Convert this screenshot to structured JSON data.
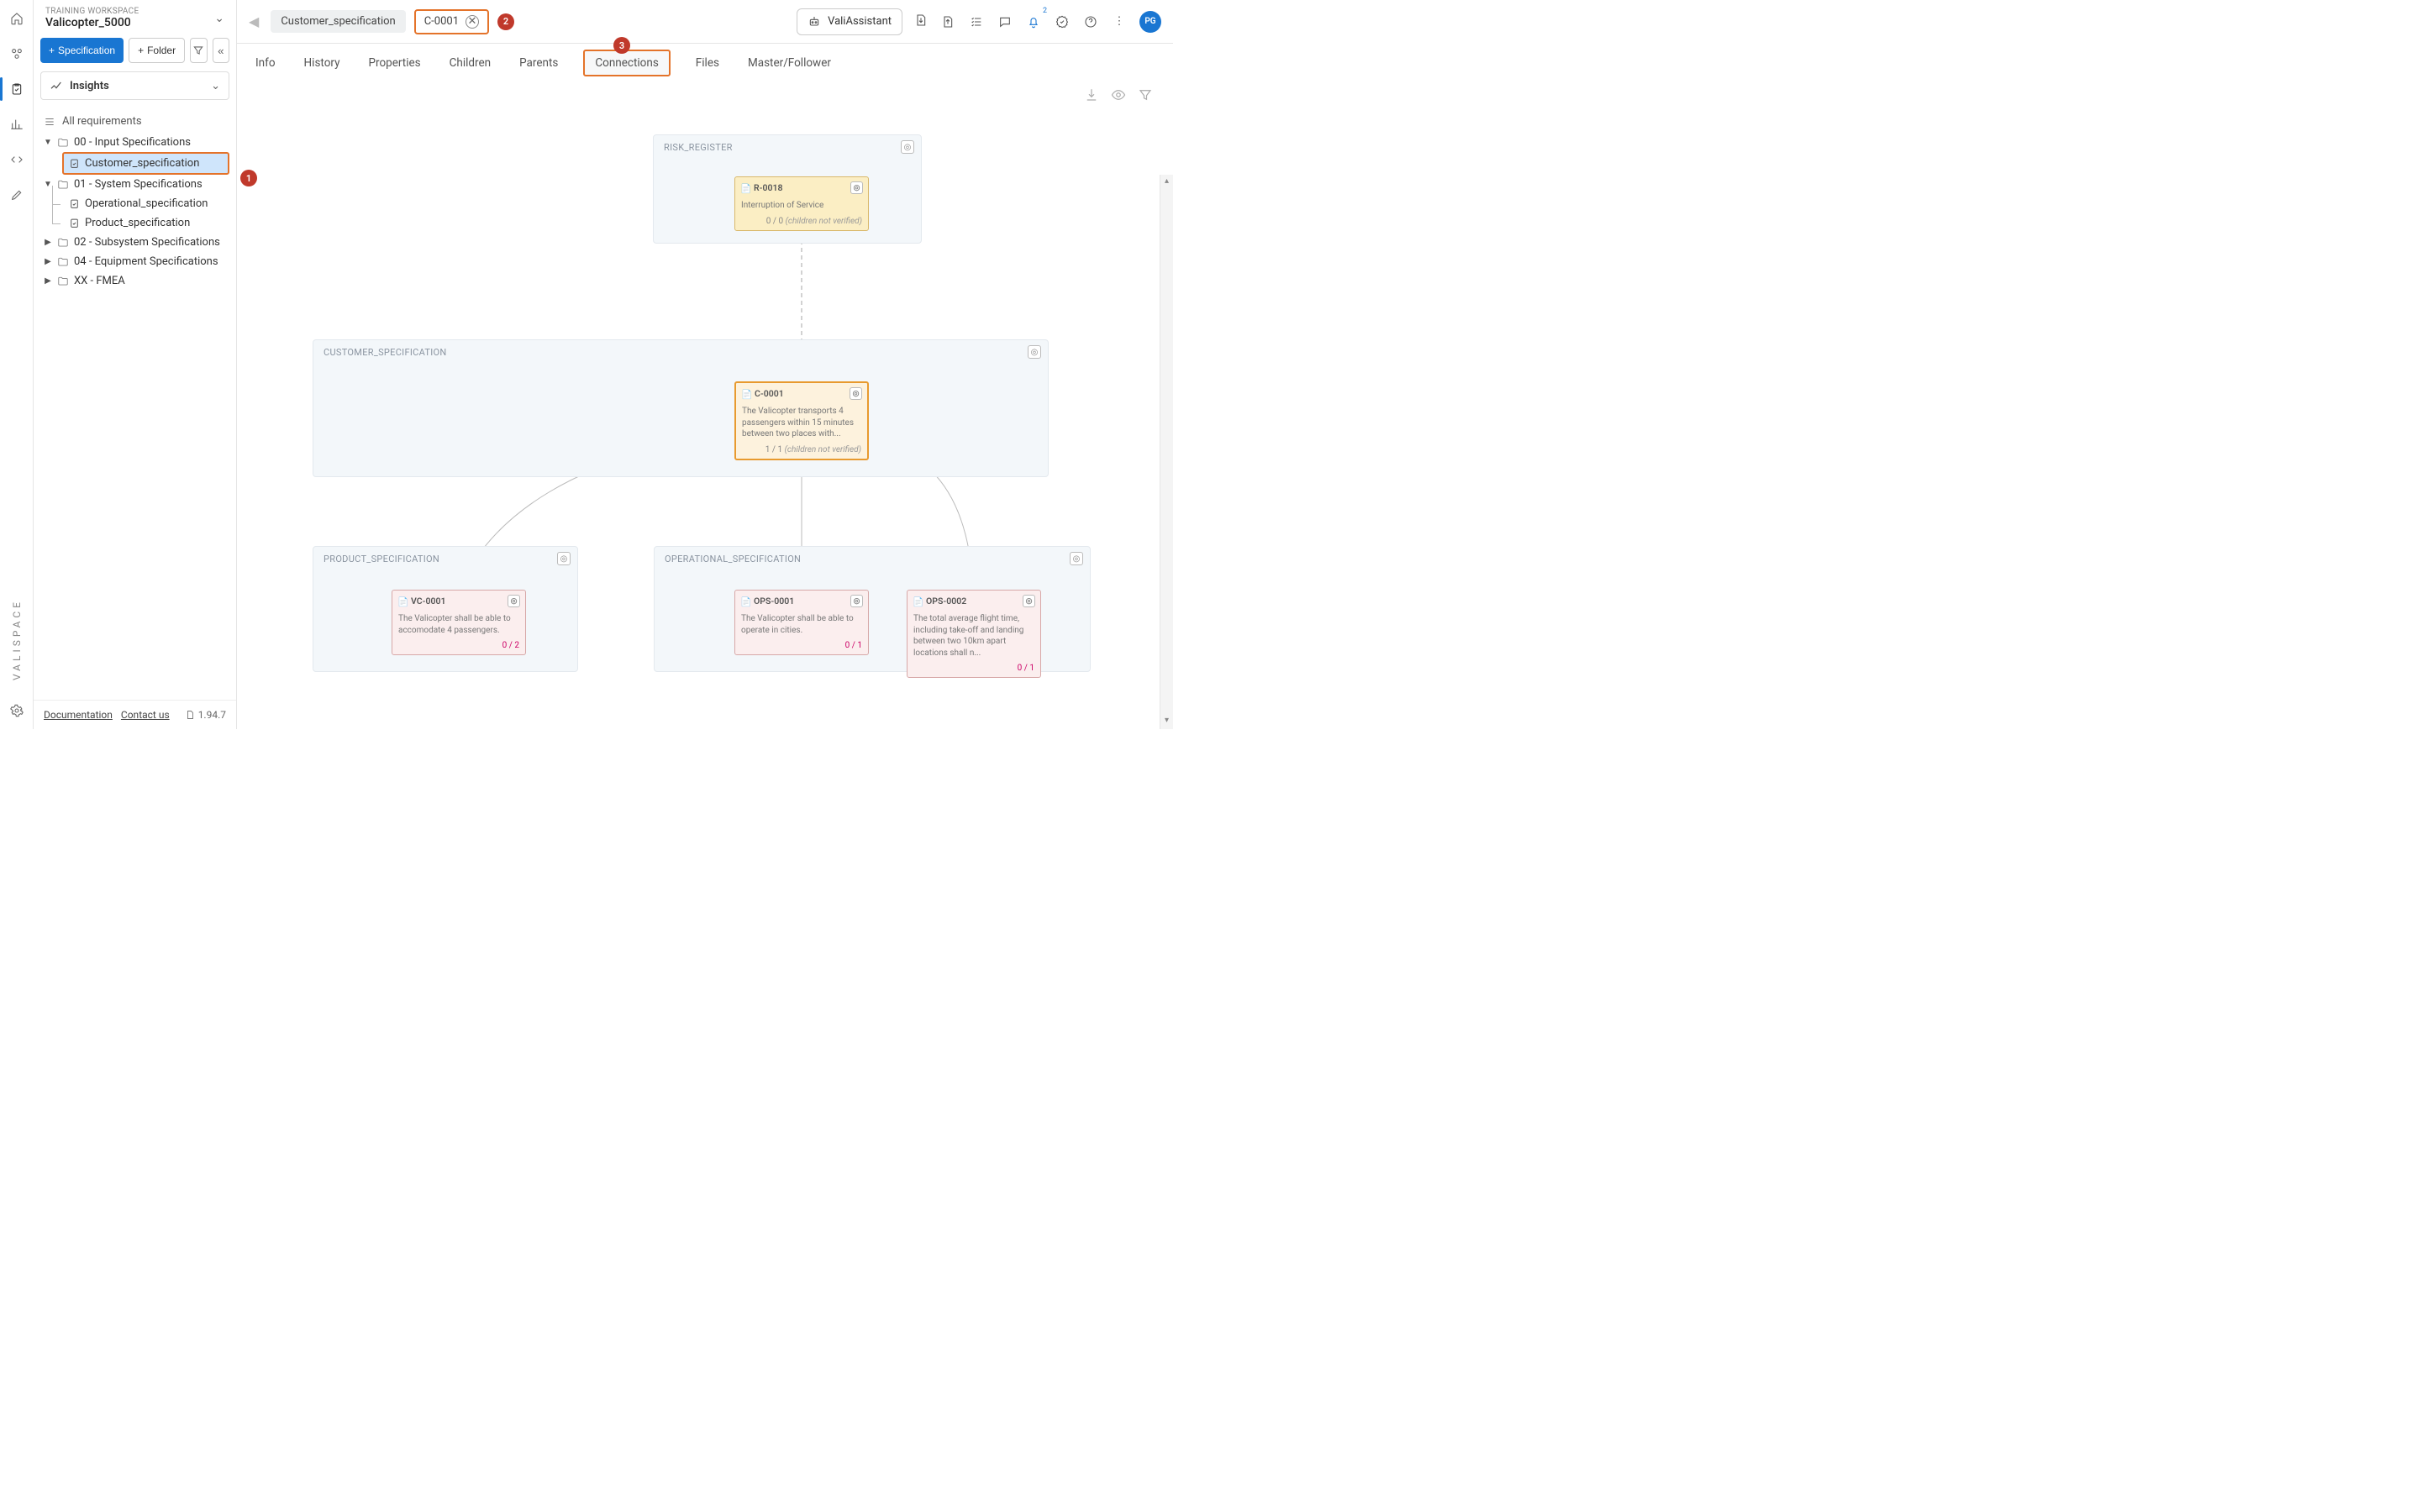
{
  "workspace": {
    "label": "TRAINING WORKSPACE",
    "name": "Valicopter_5000"
  },
  "sidebar": {
    "add_spec": "Specification",
    "add_folder": "Folder",
    "insights": "Insights",
    "all_req": "All requirements",
    "folders": {
      "input": "00 - Input Specifications",
      "input_children": {
        "cust": "Customer_specification"
      },
      "system": "01 - System Specifications",
      "system_children": {
        "ops": "Operational_specification",
        "prod": "Product_specification"
      },
      "subsys": "02 - Subsystem Specifications",
      "equip": "04 - Equipment Specifications",
      "fmea": "XX - FMEA"
    }
  },
  "footer": {
    "doc": "Documentation",
    "contact": "Contact us",
    "version": "1.94.7"
  },
  "breadcrumb": {
    "a": "Customer_specification",
    "b": "C-0001"
  },
  "steps": {
    "s1": "1",
    "s2": "2",
    "s3": "3"
  },
  "topbar": {
    "assistant": "ValiAssistant",
    "bell_count": "2",
    "avatar": "PG"
  },
  "tabs": {
    "info": "Info",
    "history": "History",
    "properties": "Properties",
    "children": "Children",
    "parents": "Parents",
    "connections": "Connections",
    "files": "Files",
    "mf": "Master/Follower"
  },
  "groups": {
    "risk": "RISK_REGISTER",
    "cust": "CUSTOMER_SPECIFICATION",
    "prod": "PRODUCT_SPECIFICATION",
    "ops": "OPERATIONAL_SPECIFICATION"
  },
  "nodes": {
    "r0018": {
      "id": "R-0018",
      "body": "Interruption of Service",
      "foot_count": "0 / 0",
      "foot_note": "(children not verified)"
    },
    "c0001": {
      "id": "C-0001",
      "body": "The Valicopter transports 4 passengers within 15 minutes between two places with...",
      "foot_count": "1 / 1",
      "foot_note": "(children not verified)"
    },
    "vc0001": {
      "id": "VC-0001",
      "body": "The Valicopter shall be able to accomodate 4 passengers.",
      "foot_count": "0 / 2"
    },
    "ops0001": {
      "id": "OPS-0001",
      "body": "The Valicopter shall be able to operate in cities.",
      "foot_count": "0 / 1"
    },
    "ops0002": {
      "id": "OPS-0002",
      "body": "The total average flight time, including take-off and landing between two 10km apart locations shall n...",
      "foot_count": "0 / 1"
    }
  },
  "brand": "VALISPACE"
}
